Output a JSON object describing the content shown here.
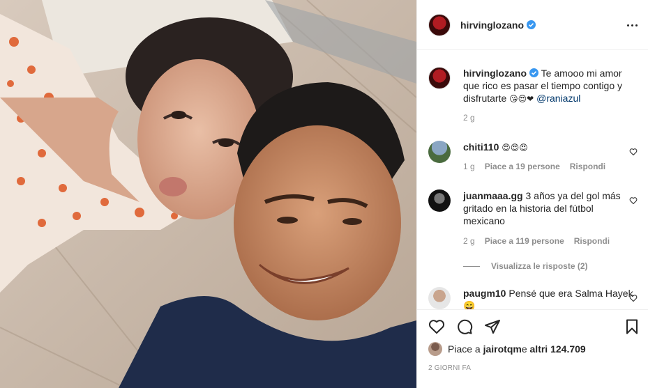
{
  "post": {
    "author": "hirvinglozano",
    "image_alt": "Selfie of a couple"
  },
  "caption": {
    "author": "hirvinglozano",
    "text": "Te amooo mi amor que rico es pasar el tiempo contigo y disfrutarte",
    "emojis": "😘😍❤",
    "mention": "@raniazul",
    "time": "2 g"
  },
  "comments": [
    {
      "author": "chiti110",
      "text": "😍😍😍",
      "time": "1 g",
      "likes": "Piace a 19 persone",
      "reply": "Rispondi"
    },
    {
      "author": "juanmaaa.gg",
      "text": "3 años ya del gol más gritado en la historia del fútbol mexicano",
      "time": "2 g",
      "likes": "Piace a 119 persone",
      "reply": "Rispondi",
      "view_replies": "Visualizza le risposte (2)"
    },
    {
      "author": "paugm10",
      "text": "Pensé que era Salma Hayek 😄"
    }
  ],
  "footer": {
    "likes_prefix": "Piace a ",
    "likes_user": "jairotqm",
    "likes_middle": " e ",
    "likes_others": "altri 124.709",
    "date": "2 GIORNI FA"
  },
  "colors": {
    "verified": "#3897f0",
    "mention": "#00376b",
    "meta": "#8e8e8e",
    "like_heart": "#ed4956"
  }
}
